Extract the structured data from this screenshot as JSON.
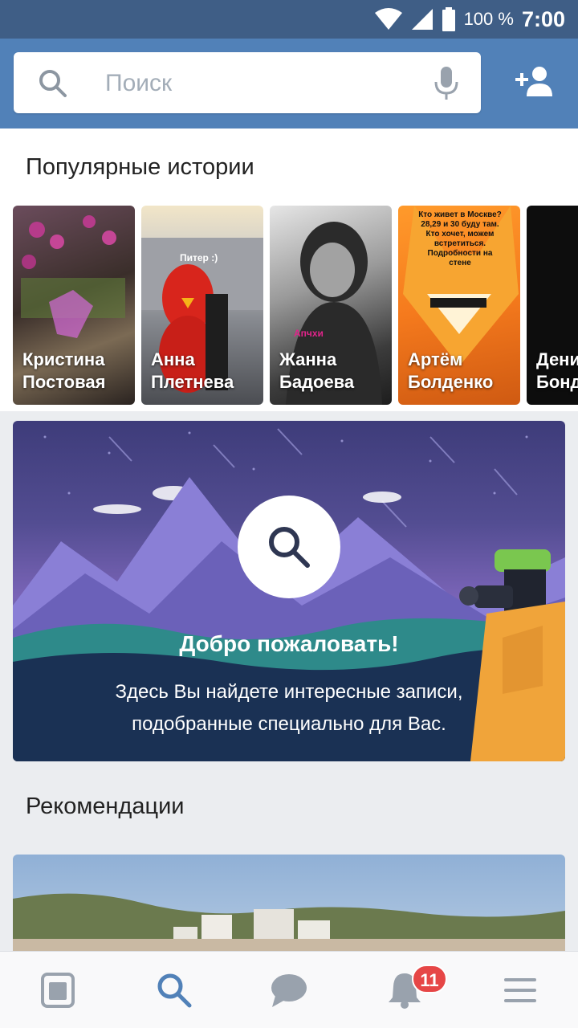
{
  "status_bar": {
    "battery": "100 %",
    "time": "7:00"
  },
  "search": {
    "placeholder": "Поиск"
  },
  "stories": {
    "title": "Популярные истории",
    "items": [
      {
        "line1": "Кристина",
        "line2": "Постовая"
      },
      {
        "line1": "Анна",
        "line2": "Плетнева",
        "caption": "Питер :)"
      },
      {
        "line1": "Жанна",
        "line2": "Бадоева",
        "caption": "Апчхи"
      },
      {
        "line1": "Артём",
        "line2": "Болденко",
        "caption": "Кто живет в Москве? 28,29 и 30 буду там. Кто хочет, можем встретиться. Подробности на стене"
      },
      {
        "line1": "Дени",
        "line2": "Бонд"
      }
    ]
  },
  "welcome": {
    "title": "Добро пожаловать!",
    "line1": "Здесь Вы найдете интересные записи,",
    "line2": "подобранные специально для Вас."
  },
  "recommendations": {
    "title": "Рекомендации"
  },
  "bottom_nav": {
    "items": [
      "news-icon",
      "search-icon",
      "messages-icon",
      "notifications-icon",
      "menu-icon"
    ],
    "active": "search",
    "notifications_badge": "11"
  },
  "colors": {
    "header": "#5181b8",
    "status_bar": "#3f5e86",
    "accent": "#5181b8",
    "badge": "#e64646"
  }
}
